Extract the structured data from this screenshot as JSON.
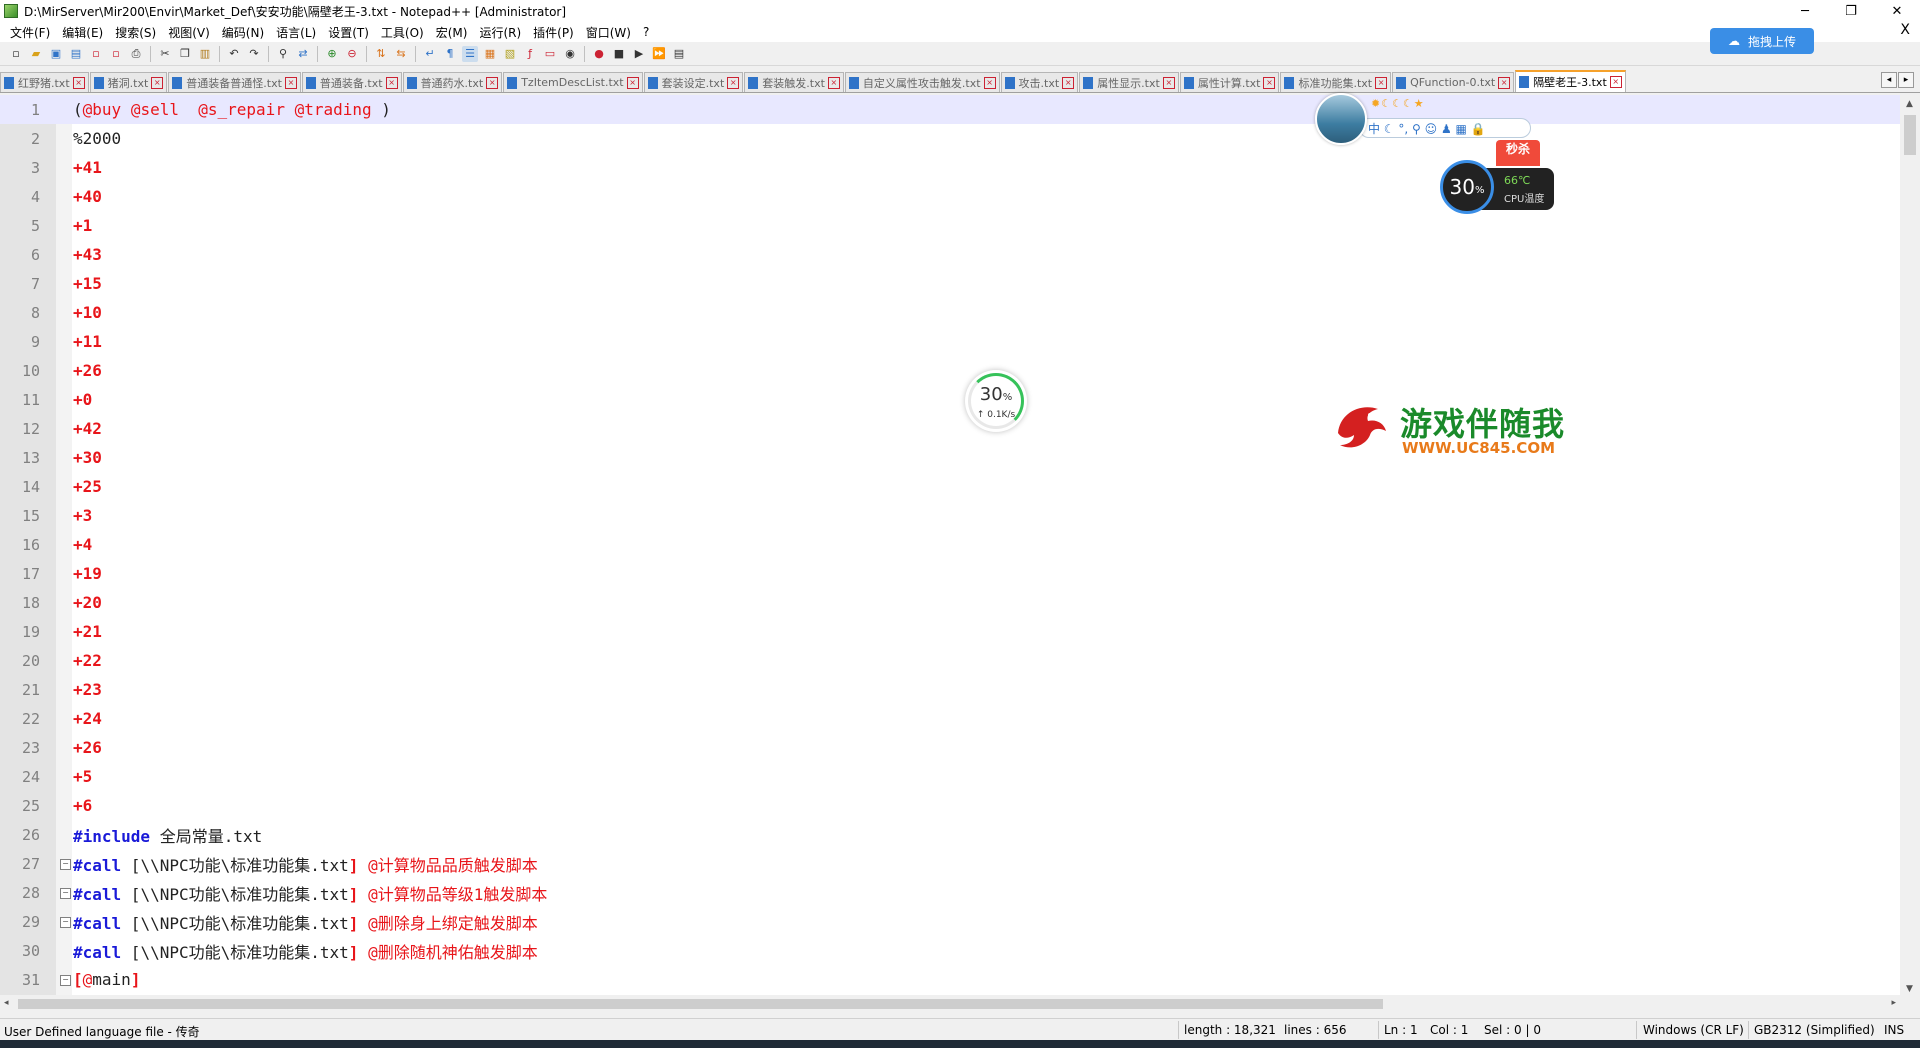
{
  "window": {
    "title": "D:\\MirServer\\Mir200\\Envir\\Market_Def\\安安功能\\隔壁老王-3.txt - Notepad++ [Administrator]",
    "minimize": "─",
    "restore": "❐",
    "close": "✕"
  },
  "menu": {
    "items": [
      "文件(F)",
      "编辑(E)",
      "搜索(S)",
      "视图(V)",
      "编码(N)",
      "语言(L)",
      "设置(T)",
      "工具(O)",
      "宏(M)",
      "运行(R)",
      "插件(P)",
      "窗口(W)",
      "?"
    ],
    "close": "X"
  },
  "upload": {
    "label": "拖拽上传"
  },
  "tabs": [
    {
      "label": "红野猪.txt"
    },
    {
      "label": "猪洞.txt"
    },
    {
      "label": "普通装备普通怪.txt"
    },
    {
      "label": "普通装备.txt"
    },
    {
      "label": "普通药水.txt"
    },
    {
      "label": "TzItemDescList.txt"
    },
    {
      "label": "套装设定.txt"
    },
    {
      "label": "套装触发.txt"
    },
    {
      "label": "自定义属性攻击触发.txt"
    },
    {
      "label": "攻击.txt"
    },
    {
      "label": "属性显示.txt"
    },
    {
      "label": "属性计算.txt"
    },
    {
      "label": "标准功能集.txt"
    },
    {
      "label": "QFunction-0.txt"
    },
    {
      "label": "隔壁老王-3.txt"
    }
  ],
  "editor": {
    "lines": [
      {
        "n": "1",
        "tokens": [
          [
            "plain",
            "("
          ],
          [
            "link",
            "@buy"
          ],
          [
            "plain",
            " "
          ],
          [
            "link",
            "@sell"
          ],
          [
            "plain",
            "  "
          ],
          [
            "link",
            "@s_repair"
          ],
          [
            "plain",
            " "
          ],
          [
            "link",
            "@trading"
          ],
          [
            "plain",
            " )"
          ]
        ]
      },
      {
        "n": "2",
        "tokens": [
          [
            "plain",
            "%2000"
          ]
        ]
      },
      {
        "n": "3",
        "tokens": [
          [
            "num",
            "+41"
          ]
        ]
      },
      {
        "n": "4",
        "tokens": [
          [
            "num",
            "+40"
          ]
        ]
      },
      {
        "n": "5",
        "tokens": [
          [
            "num",
            "+1"
          ]
        ]
      },
      {
        "n": "6",
        "tokens": [
          [
            "num",
            "+43"
          ]
        ]
      },
      {
        "n": "7",
        "tokens": [
          [
            "num",
            "+15"
          ]
        ]
      },
      {
        "n": "8",
        "tokens": [
          [
            "num",
            "+10"
          ]
        ]
      },
      {
        "n": "9",
        "tokens": [
          [
            "num",
            "+11"
          ]
        ]
      },
      {
        "n": "10",
        "tokens": [
          [
            "num",
            "+26"
          ]
        ]
      },
      {
        "n": "11",
        "tokens": [
          [
            "num",
            "+0"
          ]
        ]
      },
      {
        "n": "12",
        "tokens": [
          [
            "num",
            "+42"
          ]
        ]
      },
      {
        "n": "13",
        "tokens": [
          [
            "num",
            "+30"
          ]
        ]
      },
      {
        "n": "14",
        "tokens": [
          [
            "num",
            "+25"
          ]
        ]
      },
      {
        "n": "15",
        "tokens": [
          [
            "num",
            "+3"
          ]
        ]
      },
      {
        "n": "16",
        "tokens": [
          [
            "num",
            "+4"
          ]
        ]
      },
      {
        "n": "17",
        "tokens": [
          [
            "num",
            "+19"
          ]
        ]
      },
      {
        "n": "18",
        "tokens": [
          [
            "num",
            "+20"
          ]
        ]
      },
      {
        "n": "19",
        "tokens": [
          [
            "num",
            "+21"
          ]
        ]
      },
      {
        "n": "20",
        "tokens": [
          [
            "num",
            "+22"
          ]
        ]
      },
      {
        "n": "21",
        "tokens": [
          [
            "num",
            "+23"
          ]
        ]
      },
      {
        "n": "22",
        "tokens": [
          [
            "num",
            "+24"
          ]
        ]
      },
      {
        "n": "23",
        "tokens": [
          [
            "num",
            "+26"
          ]
        ]
      },
      {
        "n": "24",
        "tokens": [
          [
            "num",
            "+5"
          ]
        ]
      },
      {
        "n": "25",
        "tokens": [
          [
            "num",
            "+6"
          ]
        ]
      },
      {
        "n": "26",
        "tokens": [
          [
            "kw",
            "#include"
          ],
          [
            "plain",
            " 全局常量.txt"
          ]
        ]
      },
      {
        "n": "27",
        "fold": true,
        "tokens": [
          [
            "kw",
            "#call"
          ],
          [
            "plain",
            " [\\\\NPC功能\\标准功能集.txt"
          ],
          [
            "bracket",
            "]"
          ],
          [
            "plain",
            " "
          ],
          [
            "comment",
            "@计算物品品质触发脚本"
          ]
        ]
      },
      {
        "n": "28",
        "fold": true,
        "tokens": [
          [
            "kw",
            "#call"
          ],
          [
            "plain",
            " [\\\\NPC功能\\标准功能集.txt"
          ],
          [
            "bracket",
            "]"
          ],
          [
            "plain",
            " "
          ],
          [
            "comment",
            "@计算物品等级1触发脚本"
          ]
        ]
      },
      {
        "n": "29",
        "fold": true,
        "tokens": [
          [
            "kw",
            "#call"
          ],
          [
            "plain",
            " [\\\\NPC功能\\标准功能集.txt"
          ],
          [
            "bracket",
            "]"
          ],
          [
            "plain",
            " "
          ],
          [
            "comment",
            "@删除身上绑定触发脚本"
          ]
        ]
      },
      {
        "n": "30",
        "tokens": [
          [
            "kw",
            "#call"
          ],
          [
            "plain",
            " [\\\\NPC功能\\标准功能集.txt"
          ],
          [
            "bracket",
            "]"
          ],
          [
            "plain",
            " "
          ],
          [
            "comment",
            "@删除随机神佑触发脚本"
          ]
        ]
      },
      {
        "n": "31",
        "fold": true,
        "tokens": [
          [
            "bracket",
            "["
          ],
          [
            "link",
            "@"
          ],
          [
            "plain",
            "main"
          ],
          [
            "bracket",
            "]"
          ]
        ]
      }
    ]
  },
  "status": {
    "language": "User Defined language file - 传奇",
    "length": "length : 18,321",
    "lines": "lines : 656",
    "ln": "Ln : 1",
    "col": "Col : 1",
    "sel": "Sel : 0 | 0",
    "eol": "Windows (CR LF)",
    "encoding": "GB2312 (Simplified)",
    "mode": "INS"
  },
  "overlays": {
    "net_percent": "30",
    "net_percent_unit": "%",
    "net_speed": "↑ 0.1K/s",
    "watermark_title": "游戏伴随我",
    "watermark_url": "WWW.UC845.COM",
    "assist_bar": "中 ☾ °, ⚲ ☺ ♟ ▦ 🔒",
    "sale_tag": "秒杀",
    "cpu_percent": "30",
    "cpu_percent_unit": "%",
    "cpu_temp": "66℃",
    "cpu_label": "CPU温度"
  },
  "colors": {
    "number": "#e8151a",
    "keyword": "#1a1ad8",
    "active_tab_accent": "#f6a12b",
    "current_line": "#e8e8ff"
  }
}
